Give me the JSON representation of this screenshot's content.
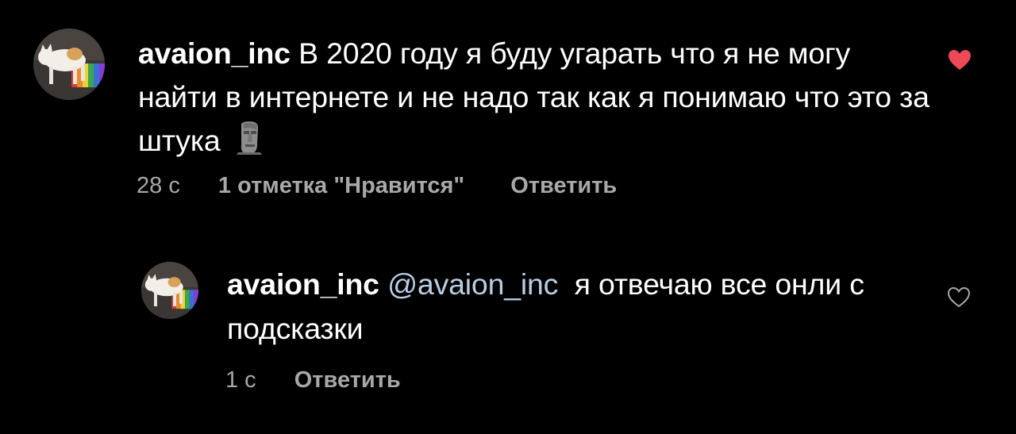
{
  "comments": [
    {
      "username": "avaion_inc",
      "text": "В 2020 году я буду угарать что я не могу найти в интернете и не надо так как я понимаю что это за штука",
      "emoji": "moai-emoji",
      "time": "28 с",
      "likes": "1 отметка \"Нравится\"",
      "reply_label": "Ответить",
      "liked": true,
      "heart_icon": "heart-filled-icon",
      "heart_color": "#ed4956"
    },
    {
      "username": "avaion_inc",
      "mention": "@avaion_inc",
      "text": "я отвечаю все онли с подсказки",
      "time": "1 с",
      "reply_label": "Ответить",
      "liked": false,
      "heart_icon": "heart-outline-icon"
    }
  ],
  "colors": {
    "background": "#000000",
    "text": "#ffffff",
    "secondary_text": "#a8a8a8",
    "mention": "#b9cde4"
  }
}
